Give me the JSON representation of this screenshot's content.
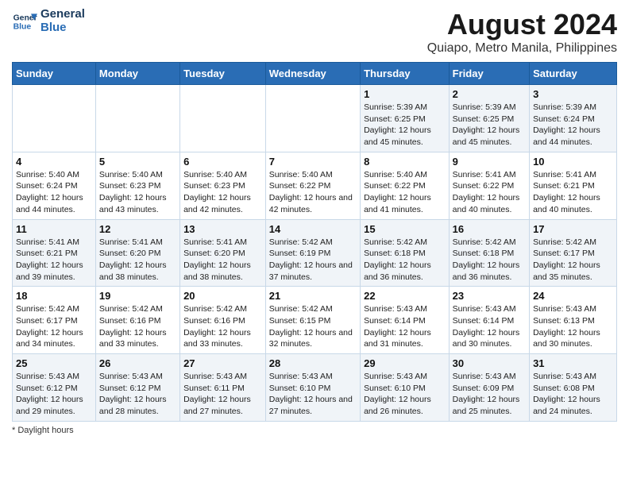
{
  "header": {
    "logo_line1": "General",
    "logo_line2": "Blue",
    "title": "August 2024",
    "subtitle": "Quiapo, Metro Manila, Philippines"
  },
  "days_of_week": [
    "Sunday",
    "Monday",
    "Tuesday",
    "Wednesday",
    "Thursday",
    "Friday",
    "Saturday"
  ],
  "weeks": [
    [
      {
        "day": null
      },
      {
        "day": null
      },
      {
        "day": null
      },
      {
        "day": null
      },
      {
        "day": 1,
        "sunrise": "Sunrise: 5:39 AM",
        "sunset": "Sunset: 6:25 PM",
        "daylight": "Daylight: 12 hours and 45 minutes."
      },
      {
        "day": 2,
        "sunrise": "Sunrise: 5:39 AM",
        "sunset": "Sunset: 6:25 PM",
        "daylight": "Daylight: 12 hours and 45 minutes."
      },
      {
        "day": 3,
        "sunrise": "Sunrise: 5:39 AM",
        "sunset": "Sunset: 6:24 PM",
        "daylight": "Daylight: 12 hours and 44 minutes."
      }
    ],
    [
      {
        "day": 4,
        "sunrise": "Sunrise: 5:40 AM",
        "sunset": "Sunset: 6:24 PM",
        "daylight": "Daylight: 12 hours and 44 minutes."
      },
      {
        "day": 5,
        "sunrise": "Sunrise: 5:40 AM",
        "sunset": "Sunset: 6:23 PM",
        "daylight": "Daylight: 12 hours and 43 minutes."
      },
      {
        "day": 6,
        "sunrise": "Sunrise: 5:40 AM",
        "sunset": "Sunset: 6:23 PM",
        "daylight": "Daylight: 12 hours and 42 minutes."
      },
      {
        "day": 7,
        "sunrise": "Sunrise: 5:40 AM",
        "sunset": "Sunset: 6:22 PM",
        "daylight": "Daylight: 12 hours and 42 minutes."
      },
      {
        "day": 8,
        "sunrise": "Sunrise: 5:40 AM",
        "sunset": "Sunset: 6:22 PM",
        "daylight": "Daylight: 12 hours and 41 minutes."
      },
      {
        "day": 9,
        "sunrise": "Sunrise: 5:41 AM",
        "sunset": "Sunset: 6:22 PM",
        "daylight": "Daylight: 12 hours and 40 minutes."
      },
      {
        "day": 10,
        "sunrise": "Sunrise: 5:41 AM",
        "sunset": "Sunset: 6:21 PM",
        "daylight": "Daylight: 12 hours and 40 minutes."
      }
    ],
    [
      {
        "day": 11,
        "sunrise": "Sunrise: 5:41 AM",
        "sunset": "Sunset: 6:21 PM",
        "daylight": "Daylight: 12 hours and 39 minutes."
      },
      {
        "day": 12,
        "sunrise": "Sunrise: 5:41 AM",
        "sunset": "Sunset: 6:20 PM",
        "daylight": "Daylight: 12 hours and 38 minutes."
      },
      {
        "day": 13,
        "sunrise": "Sunrise: 5:41 AM",
        "sunset": "Sunset: 6:20 PM",
        "daylight": "Daylight: 12 hours and 38 minutes."
      },
      {
        "day": 14,
        "sunrise": "Sunrise: 5:42 AM",
        "sunset": "Sunset: 6:19 PM",
        "daylight": "Daylight: 12 hours and 37 minutes."
      },
      {
        "day": 15,
        "sunrise": "Sunrise: 5:42 AM",
        "sunset": "Sunset: 6:18 PM",
        "daylight": "Daylight: 12 hours and 36 minutes."
      },
      {
        "day": 16,
        "sunrise": "Sunrise: 5:42 AM",
        "sunset": "Sunset: 6:18 PM",
        "daylight": "Daylight: 12 hours and 36 minutes."
      },
      {
        "day": 17,
        "sunrise": "Sunrise: 5:42 AM",
        "sunset": "Sunset: 6:17 PM",
        "daylight": "Daylight: 12 hours and 35 minutes."
      }
    ],
    [
      {
        "day": 18,
        "sunrise": "Sunrise: 5:42 AM",
        "sunset": "Sunset: 6:17 PM",
        "daylight": "Daylight: 12 hours and 34 minutes."
      },
      {
        "day": 19,
        "sunrise": "Sunrise: 5:42 AM",
        "sunset": "Sunset: 6:16 PM",
        "daylight": "Daylight: 12 hours and 33 minutes."
      },
      {
        "day": 20,
        "sunrise": "Sunrise: 5:42 AM",
        "sunset": "Sunset: 6:16 PM",
        "daylight": "Daylight: 12 hours and 33 minutes."
      },
      {
        "day": 21,
        "sunrise": "Sunrise: 5:42 AM",
        "sunset": "Sunset: 6:15 PM",
        "daylight": "Daylight: 12 hours and 32 minutes."
      },
      {
        "day": 22,
        "sunrise": "Sunrise: 5:43 AM",
        "sunset": "Sunset: 6:14 PM",
        "daylight": "Daylight: 12 hours and 31 minutes."
      },
      {
        "day": 23,
        "sunrise": "Sunrise: 5:43 AM",
        "sunset": "Sunset: 6:14 PM",
        "daylight": "Daylight: 12 hours and 30 minutes."
      },
      {
        "day": 24,
        "sunrise": "Sunrise: 5:43 AM",
        "sunset": "Sunset: 6:13 PM",
        "daylight": "Daylight: 12 hours and 30 minutes."
      }
    ],
    [
      {
        "day": 25,
        "sunrise": "Sunrise: 5:43 AM",
        "sunset": "Sunset: 6:12 PM",
        "daylight": "Daylight: 12 hours and 29 minutes."
      },
      {
        "day": 26,
        "sunrise": "Sunrise: 5:43 AM",
        "sunset": "Sunset: 6:12 PM",
        "daylight": "Daylight: 12 hours and 28 minutes."
      },
      {
        "day": 27,
        "sunrise": "Sunrise: 5:43 AM",
        "sunset": "Sunset: 6:11 PM",
        "daylight": "Daylight: 12 hours and 27 minutes."
      },
      {
        "day": 28,
        "sunrise": "Sunrise: 5:43 AM",
        "sunset": "Sunset: 6:10 PM",
        "daylight": "Daylight: 12 hours and 27 minutes."
      },
      {
        "day": 29,
        "sunrise": "Sunrise: 5:43 AM",
        "sunset": "Sunset: 6:10 PM",
        "daylight": "Daylight: 12 hours and 26 minutes."
      },
      {
        "day": 30,
        "sunrise": "Sunrise: 5:43 AM",
        "sunset": "Sunset: 6:09 PM",
        "daylight": "Daylight: 12 hours and 25 minutes."
      },
      {
        "day": 31,
        "sunrise": "Sunrise: 5:43 AM",
        "sunset": "Sunset: 6:08 PM",
        "daylight": "Daylight: 12 hours and 24 minutes."
      }
    ]
  ],
  "footer": {
    "note": "Daylight hours"
  }
}
